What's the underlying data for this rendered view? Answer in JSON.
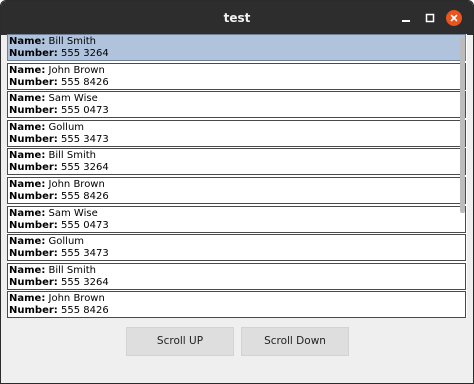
{
  "window": {
    "title": "test"
  },
  "list": {
    "name_label": "Name:",
    "number_label": "Number:",
    "items": [
      {
        "name": "Bill Smith",
        "number": "555 3264",
        "selected": true
      },
      {
        "name": "John Brown",
        "number": "555 8426",
        "selected": false
      },
      {
        "name": "Sam Wise",
        "number": "555 0473",
        "selected": false
      },
      {
        "name": "Gollum",
        "number": "555 3473",
        "selected": false
      },
      {
        "name": "Bill Smith",
        "number": "555 3264",
        "selected": false
      },
      {
        "name": "John Brown",
        "number": "555 8426",
        "selected": false
      },
      {
        "name": "Sam Wise",
        "number": "555 0473",
        "selected": false
      },
      {
        "name": "Gollum",
        "number": "555 3473",
        "selected": false
      },
      {
        "name": "Bill Smith",
        "number": "555 3264",
        "selected": false
      },
      {
        "name": "John Brown",
        "number": "555 8426",
        "selected": false
      }
    ]
  },
  "buttons": {
    "scroll_up": "Scroll UP",
    "scroll_down": "Scroll Down"
  },
  "colors": {
    "selection": "#b0c3dd",
    "titlebar": "#2d2d2d",
    "close_button": "#e9541f"
  },
  "icons": {
    "minimize": "minimize-icon",
    "maximize": "maximize-icon",
    "close": "close-icon"
  }
}
